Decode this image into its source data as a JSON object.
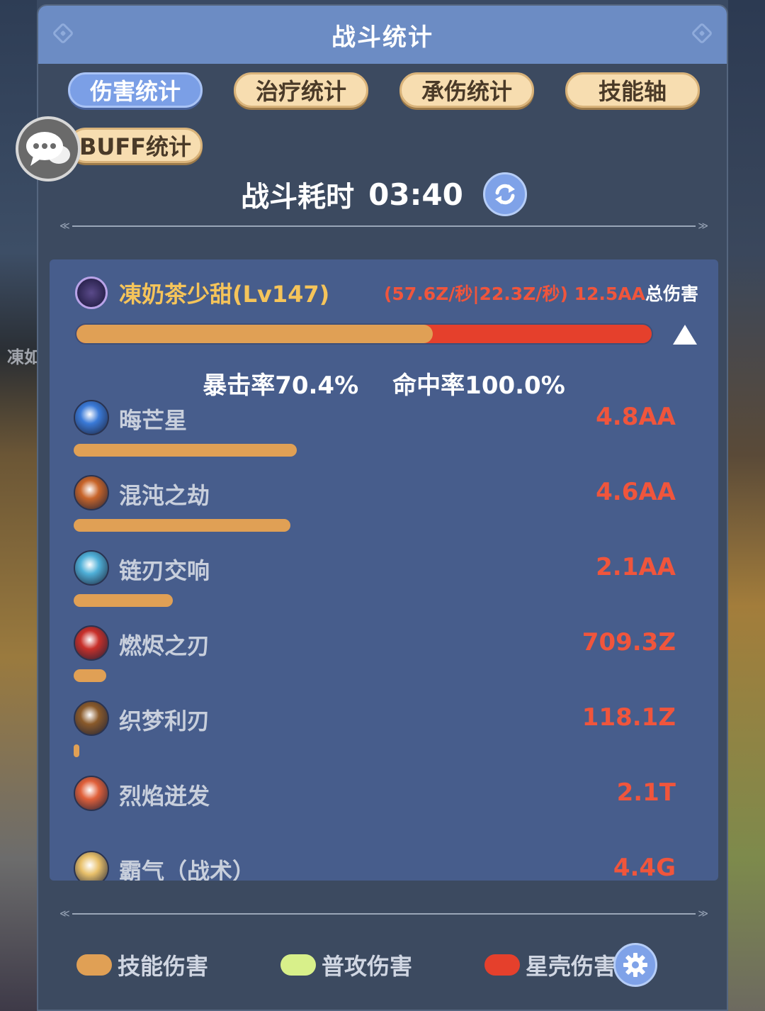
{
  "title": "战斗统计",
  "tabs": [
    {
      "label": "伤害统计",
      "active": true
    },
    {
      "label": "治疗统计",
      "active": false
    },
    {
      "label": "承伤统计",
      "active": false
    },
    {
      "label": "技能轴",
      "active": false
    },
    {
      "label": "BUFF统计",
      "active": false
    }
  ],
  "battle": {
    "duration_label": "战斗耗时",
    "duration": "03:40"
  },
  "player": {
    "name": "凍奶茶少甜(Lv147)",
    "dps": "(57.6Z/秒|22.3Z/秒)",
    "total": "12.5AA",
    "total_label": "总伤害",
    "skill_damage_share": 0.62
  },
  "rates": {
    "crit": "暴击率70.4%",
    "hit": "命中率100.0%"
  },
  "skills": [
    {
      "name": "晦芒星",
      "value": "4.8AA",
      "share": 0.37,
      "icon": "star-skill-icon",
      "color": "#3a7ad8"
    },
    {
      "name": "混沌之劫",
      "value": "4.6AA",
      "share": 0.36,
      "icon": "chaos-skill-icon",
      "color": "#c8652a"
    },
    {
      "name": "链刃交响",
      "value": "2.1AA",
      "share": 0.165,
      "icon": "chain-blade-skill-icon",
      "color": "#4fb0d8"
    },
    {
      "name": "燃烬之刃",
      "value": "709.3Z",
      "share": 0.054,
      "icon": "fire-blade-skill-icon",
      "color": "#c8302a"
    },
    {
      "name": "织梦利刃",
      "value": "118.1Z",
      "share": 0.009,
      "icon": "dream-blade-skill-icon",
      "color": "#8a5a2a"
    },
    {
      "name": "烈焰迸发",
      "value": "2.1T",
      "share": 0,
      "icon": "flame-burst-skill-icon",
      "color": "#e0603a"
    },
    {
      "name": "霸气（战术）",
      "value": "4.4G",
      "share": 0,
      "icon": "domineer-skill-icon",
      "color": "#e8c06a"
    }
  ],
  "legend": [
    {
      "label": "技能伤害",
      "color": "#e0a055"
    },
    {
      "label": "普攻伤害",
      "color": "#d8f08a"
    },
    {
      "label": "星壳伤害",
      "color": "#e5402c"
    }
  ],
  "background_text": "凍如"
}
